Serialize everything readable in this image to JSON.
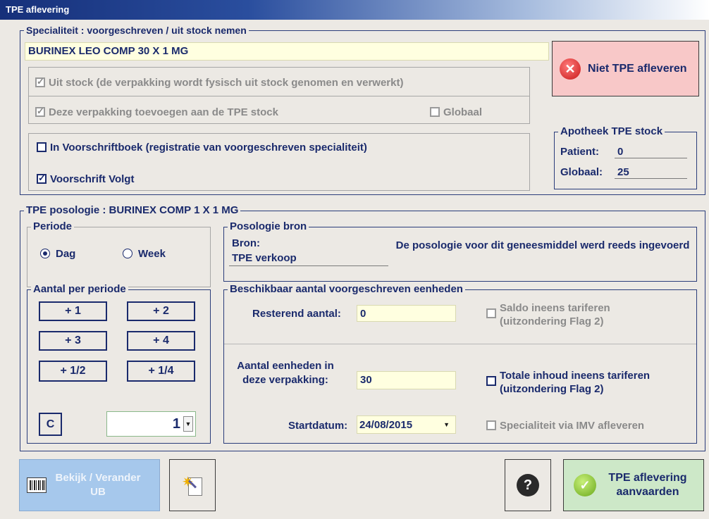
{
  "window": {
    "title": "TPE aflevering"
  },
  "specialty": {
    "legend": "Specialiteit : voorgeschreven / uit stock nemen",
    "name": "BURINEX LEO COMP  30 X 1 MG",
    "uit_stock_label": "Uit stock (de verpakking wordt fysisch uit stock genomen en verwerkt)",
    "toevoegen_label": "Deze verpakking toevoegen aan de TPE stock",
    "globaal_label": "Globaal",
    "voorschriftboek_label": "In Voorschriftboek (registratie van voorgeschreven specialiteit)",
    "voorschrift_volgt_label": "Voorschrift Volgt"
  },
  "niet_tpe_button": "Niet TPE afleveren",
  "apotheek": {
    "legend": "Apotheek TPE stock",
    "patient_label": "Patient:",
    "patient_value": "0",
    "globaal_label": "Globaal:",
    "globaal_value": "25"
  },
  "posologie": {
    "legend": "TPE posologie : BURINEX COMP 1 X 1 MG",
    "periode_legend": "Periode",
    "dag_label": "Dag",
    "week_label": "Week",
    "bron_legend": "Posologie bron",
    "bron_label": "Bron:",
    "bron_value": "TPE verkoop",
    "bron_message": "De posologie voor dit geneesmiddel werd reeds ingevoerd",
    "aantal_legend": "Aantal per periode",
    "buttons": [
      "+ 1",
      "+ 2",
      "+ 3",
      "+ 4",
      "+ 1/2",
      "+ 1/4"
    ],
    "clear_label": "C",
    "amount_value": "1"
  },
  "beschikbaar": {
    "legend": "Beschikbaar aantal voorgeschreven eenheden",
    "resterend_label": "Resterend aantal:",
    "resterend_value": "0",
    "saldo_label": "Saldo ineens tariferen (uitzondering Flag 2)",
    "eenheden_label": "Aantal eenheden in deze verpakking:",
    "eenheden_value": "30",
    "totale_label": "Totale inhoud ineens tariferen (uitzondering Flag 2)",
    "startdatum_label": "Startdatum:",
    "startdatum_value": "24/08/2015",
    "imv_label": "Specialiteit via IMV afleveren"
  },
  "footer": {
    "bekijk_label": "Bekijk / Verander UB",
    "aanvaarden_label": "TPE aflevering aanvaarden"
  },
  "colors": {
    "accent": "#1a2a6c",
    "cancel_bg": "#f8c8c8",
    "accept_bg": "#cde8c8",
    "barcode_bg": "#a6c8ec",
    "field_bg": "#ffffe0"
  }
}
